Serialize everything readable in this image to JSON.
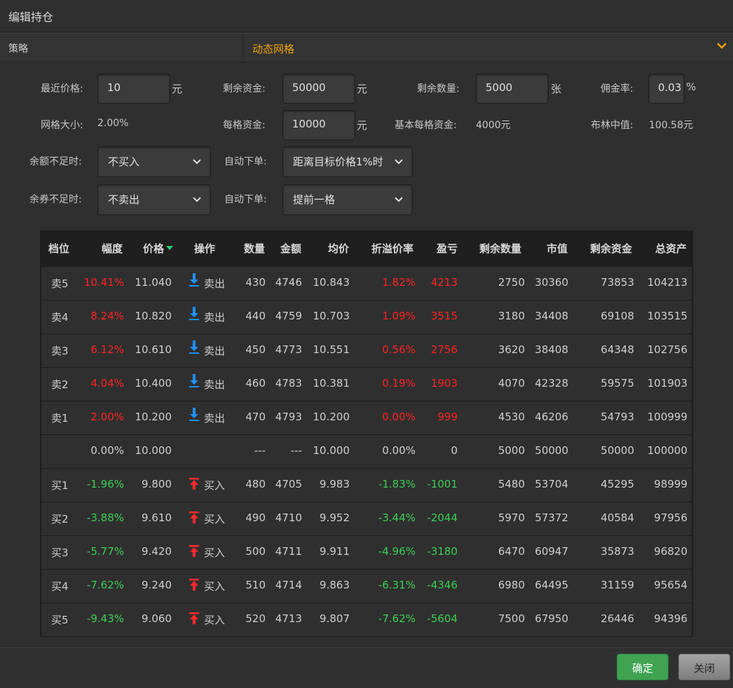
{
  "title": "编辑持仓",
  "strategy": {
    "label": "策略",
    "value": "动态网格"
  },
  "params": {
    "recent_price_label": "最近价格:",
    "recent_price_value": "10",
    "recent_price_unit": "元",
    "remain_funds_label": "剩余资金:",
    "remain_funds_value": "50000",
    "remain_funds_unit": "元",
    "remain_qty_label": "剩余数量:",
    "remain_qty_value": "5000",
    "remain_qty_unit": "张",
    "commission_label": "佣金率:",
    "commission_value": "0.03",
    "commission_unit": "%",
    "grid_size_label": "网格大小:",
    "grid_size_value": "2.00%",
    "per_grid_funds_label": "每格资金:",
    "per_grid_funds_value": "10000",
    "per_grid_funds_unit": "元",
    "base_grid_funds_label": "基本每格资金:",
    "base_grid_funds_value": "4000元",
    "bollinger_mid_label": "布林中值:",
    "bollinger_mid_value": "100.58元",
    "insufficient_cash_label": "余额不足时:",
    "insufficient_cash_value": "不买入",
    "auto_order1_label": "自动下单:",
    "auto_order1_value": "距离目标价格1%时",
    "insufficient_shares_label": "余券不足时:",
    "insufficient_shares_value": "不卖出",
    "auto_order2_label": "自动下单:",
    "auto_order2_value": "提前一格"
  },
  "table": {
    "headers": [
      "档位",
      "幅度",
      "价格",
      "操作",
      "数量",
      "金额",
      "均价",
      "折溢价率",
      "盈亏",
      "剩余数量",
      "市值",
      "剩余资金",
      "总资产"
    ],
    "rows": [
      {
        "level": "卖5",
        "range": "10.41%",
        "price": "11.040",
        "action": "卖出",
        "qty": "430",
        "amount": "4746",
        "avg": "10.843",
        "premium": "1.82%",
        "pnl": "4213",
        "rqty": "2750",
        "mv": "30360",
        "rfunds": "73853",
        "total": "104213",
        "tone": "red",
        "dir": "sell"
      },
      {
        "level": "卖4",
        "range": "8.24%",
        "price": "10.820",
        "action": "卖出",
        "qty": "440",
        "amount": "4759",
        "avg": "10.703",
        "premium": "1.09%",
        "pnl": "3515",
        "rqty": "3180",
        "mv": "34408",
        "rfunds": "69108",
        "total": "103515",
        "tone": "red",
        "dir": "sell"
      },
      {
        "level": "卖3",
        "range": "6.12%",
        "price": "10.610",
        "action": "卖出",
        "qty": "450",
        "amount": "4773",
        "avg": "10.551",
        "premium": "0.56%",
        "pnl": "2756",
        "rqty": "3620",
        "mv": "38408",
        "rfunds": "64348",
        "total": "102756",
        "tone": "red",
        "dir": "sell"
      },
      {
        "level": "卖2",
        "range": "4.04%",
        "price": "10.400",
        "action": "卖出",
        "qty": "460",
        "amount": "4783",
        "avg": "10.381",
        "premium": "0.19%",
        "pnl": "1903",
        "rqty": "4070",
        "mv": "42328",
        "rfunds": "59575",
        "total": "101903",
        "tone": "red",
        "dir": "sell"
      },
      {
        "level": "卖1",
        "range": "2.00%",
        "price": "10.200",
        "action": "卖出",
        "qty": "470",
        "amount": "4793",
        "avg": "10.200",
        "premium": "0.00%",
        "pnl": "999",
        "rqty": "4530",
        "mv": "46206",
        "rfunds": "54793",
        "total": "100999",
        "tone": "red",
        "dir": "sell"
      },
      {
        "level": "",
        "range": "0.00%",
        "price": "10.000",
        "action": "",
        "qty": "---",
        "amount": "---",
        "avg": "10.000",
        "premium": "0.00%",
        "pnl": "0",
        "rqty": "5000",
        "mv": "50000",
        "rfunds": "50000",
        "total": "100000",
        "tone": "neutral",
        "dir": ""
      },
      {
        "level": "买1",
        "range": "-1.96%",
        "price": "9.800",
        "action": "买入",
        "qty": "480",
        "amount": "4705",
        "avg": "9.983",
        "premium": "-1.83%",
        "pnl": "-1001",
        "rqty": "5480",
        "mv": "53704",
        "rfunds": "45295",
        "total": "98999",
        "tone": "green",
        "dir": "buy"
      },
      {
        "level": "买2",
        "range": "-3.88%",
        "price": "9.610",
        "action": "买入",
        "qty": "490",
        "amount": "4710",
        "avg": "9.952",
        "premium": "-3.44%",
        "pnl": "-2044",
        "rqty": "5970",
        "mv": "57372",
        "rfunds": "40584",
        "total": "97956",
        "tone": "green",
        "dir": "buy"
      },
      {
        "level": "买3",
        "range": "-5.77%",
        "price": "9.420",
        "action": "买入",
        "qty": "500",
        "amount": "4711",
        "avg": "9.911",
        "premium": "-4.96%",
        "pnl": "-3180",
        "rqty": "6470",
        "mv": "60947",
        "rfunds": "35873",
        "total": "96820",
        "tone": "green",
        "dir": "buy"
      },
      {
        "level": "买4",
        "range": "-7.62%",
        "price": "9.240",
        "action": "买入",
        "qty": "510",
        "amount": "4714",
        "avg": "9.863",
        "premium": "-6.31%",
        "pnl": "-4346",
        "rqty": "6980",
        "mv": "64495",
        "rfunds": "31159",
        "total": "95654",
        "tone": "green",
        "dir": "buy"
      },
      {
        "level": "买5",
        "range": "-9.43%",
        "price": "9.060",
        "action": "买入",
        "qty": "520",
        "amount": "4713",
        "avg": "9.807",
        "premium": "-7.62%",
        "pnl": "-5604",
        "rqty": "7500",
        "mv": "67950",
        "rfunds": "26446",
        "total": "94396",
        "tone": "green",
        "dir": "buy"
      }
    ]
  },
  "footer": {
    "ok_label": "确定",
    "close_label": "关闭"
  },
  "colors": {
    "accent": "#f0a30a",
    "up": "#ff2222",
    "down": "#3ccf55",
    "sort": "#2ecc71",
    "sell_icon": "#1e90ff",
    "buy_icon": "#ff2a2a"
  },
  "icons": {
    "sell": "arrow-down-to-line-icon",
    "buy": "arrow-up-from-line-icon",
    "sort": "caret-down-icon",
    "dropdown": "chevron-down-icon"
  }
}
